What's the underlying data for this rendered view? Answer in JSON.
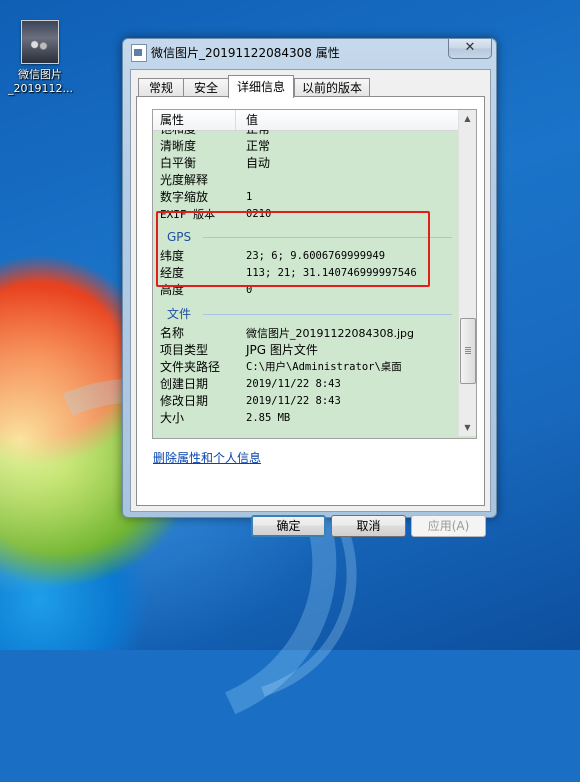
{
  "desktop": {
    "icon_label_line1": "微信图片",
    "icon_label_line2": "_2019112..."
  },
  "window": {
    "title": "微信图片_20191122084308 属性",
    "close_glyph": "✕"
  },
  "tabs": [
    {
      "label": "常规"
    },
    {
      "label": "安全"
    },
    {
      "label": "详细信息",
      "active": true
    },
    {
      "label": "以前的版本"
    }
  ],
  "table": {
    "columns": {
      "property": "属性",
      "value": "值"
    },
    "clipped_row": {
      "key": "饱和度",
      "value": "正常"
    },
    "camera_rows": [
      {
        "key": "清晰度",
        "value": "正常"
      },
      {
        "key": "白平衡",
        "value": "自动"
      },
      {
        "key": "光度解释",
        "value": ""
      },
      {
        "key": "数字缩放",
        "value": "1"
      },
      {
        "key": "EXIF 版本",
        "value": "0210"
      }
    ],
    "gps_group": "GPS",
    "gps_rows": [
      {
        "key": "纬度",
        "value": "23; 6; 9.6006769999949"
      },
      {
        "key": "经度",
        "value": "113; 21; 31.140746999997546"
      },
      {
        "key": "高度",
        "value": "0"
      }
    ],
    "file_group": "文件",
    "file_rows": [
      {
        "key": "名称",
        "value": "微信图片_20191122084308.jpg"
      },
      {
        "key": "项目类型",
        "value": "JPG 图片文件"
      },
      {
        "key": "文件夹路径",
        "value": "C:\\用户\\Administrator\\桌面"
      },
      {
        "key": "创建日期",
        "value": "2019/11/22 8:43"
      },
      {
        "key": "修改日期",
        "value": "2019/11/22 8:43"
      },
      {
        "key": "大小",
        "value": "2.85 MB"
      }
    ]
  },
  "link_remove": "删除属性和个人信息",
  "buttons": {
    "ok": "确定",
    "cancel": "取消",
    "apply": "应用(A)"
  },
  "colors": {
    "highlight_border": "#e31c1c",
    "row_background": "#cfe7cf",
    "group_heading": "#1e4f9c"
  }
}
